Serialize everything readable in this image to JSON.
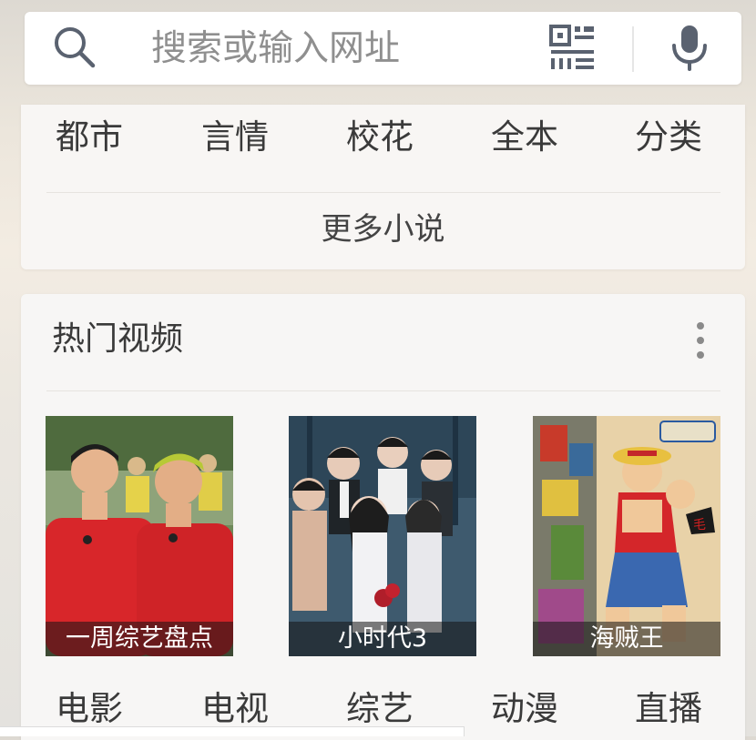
{
  "search": {
    "placeholder": "搜索或输入网址"
  },
  "novels": {
    "categories": [
      {
        "label": "都市"
      },
      {
        "label": "言情"
      },
      {
        "label": "校花"
      },
      {
        "label": "全本"
      },
      {
        "label": "分类"
      }
    ],
    "more_label": "更多小说"
  },
  "hot_videos": {
    "title": "热门视频",
    "items": [
      {
        "caption": "一周综艺盘点"
      },
      {
        "caption": "小时代3"
      },
      {
        "caption": "海贼王"
      }
    ],
    "categories": [
      {
        "label": "电影"
      },
      {
        "label": "电视"
      },
      {
        "label": "综艺"
      },
      {
        "label": "动漫"
      },
      {
        "label": "直播"
      }
    ]
  },
  "colors": {
    "icon_gray": "#5a6270",
    "text_dark": "#3a3a3a",
    "placeholder": "#8f8f8f"
  }
}
